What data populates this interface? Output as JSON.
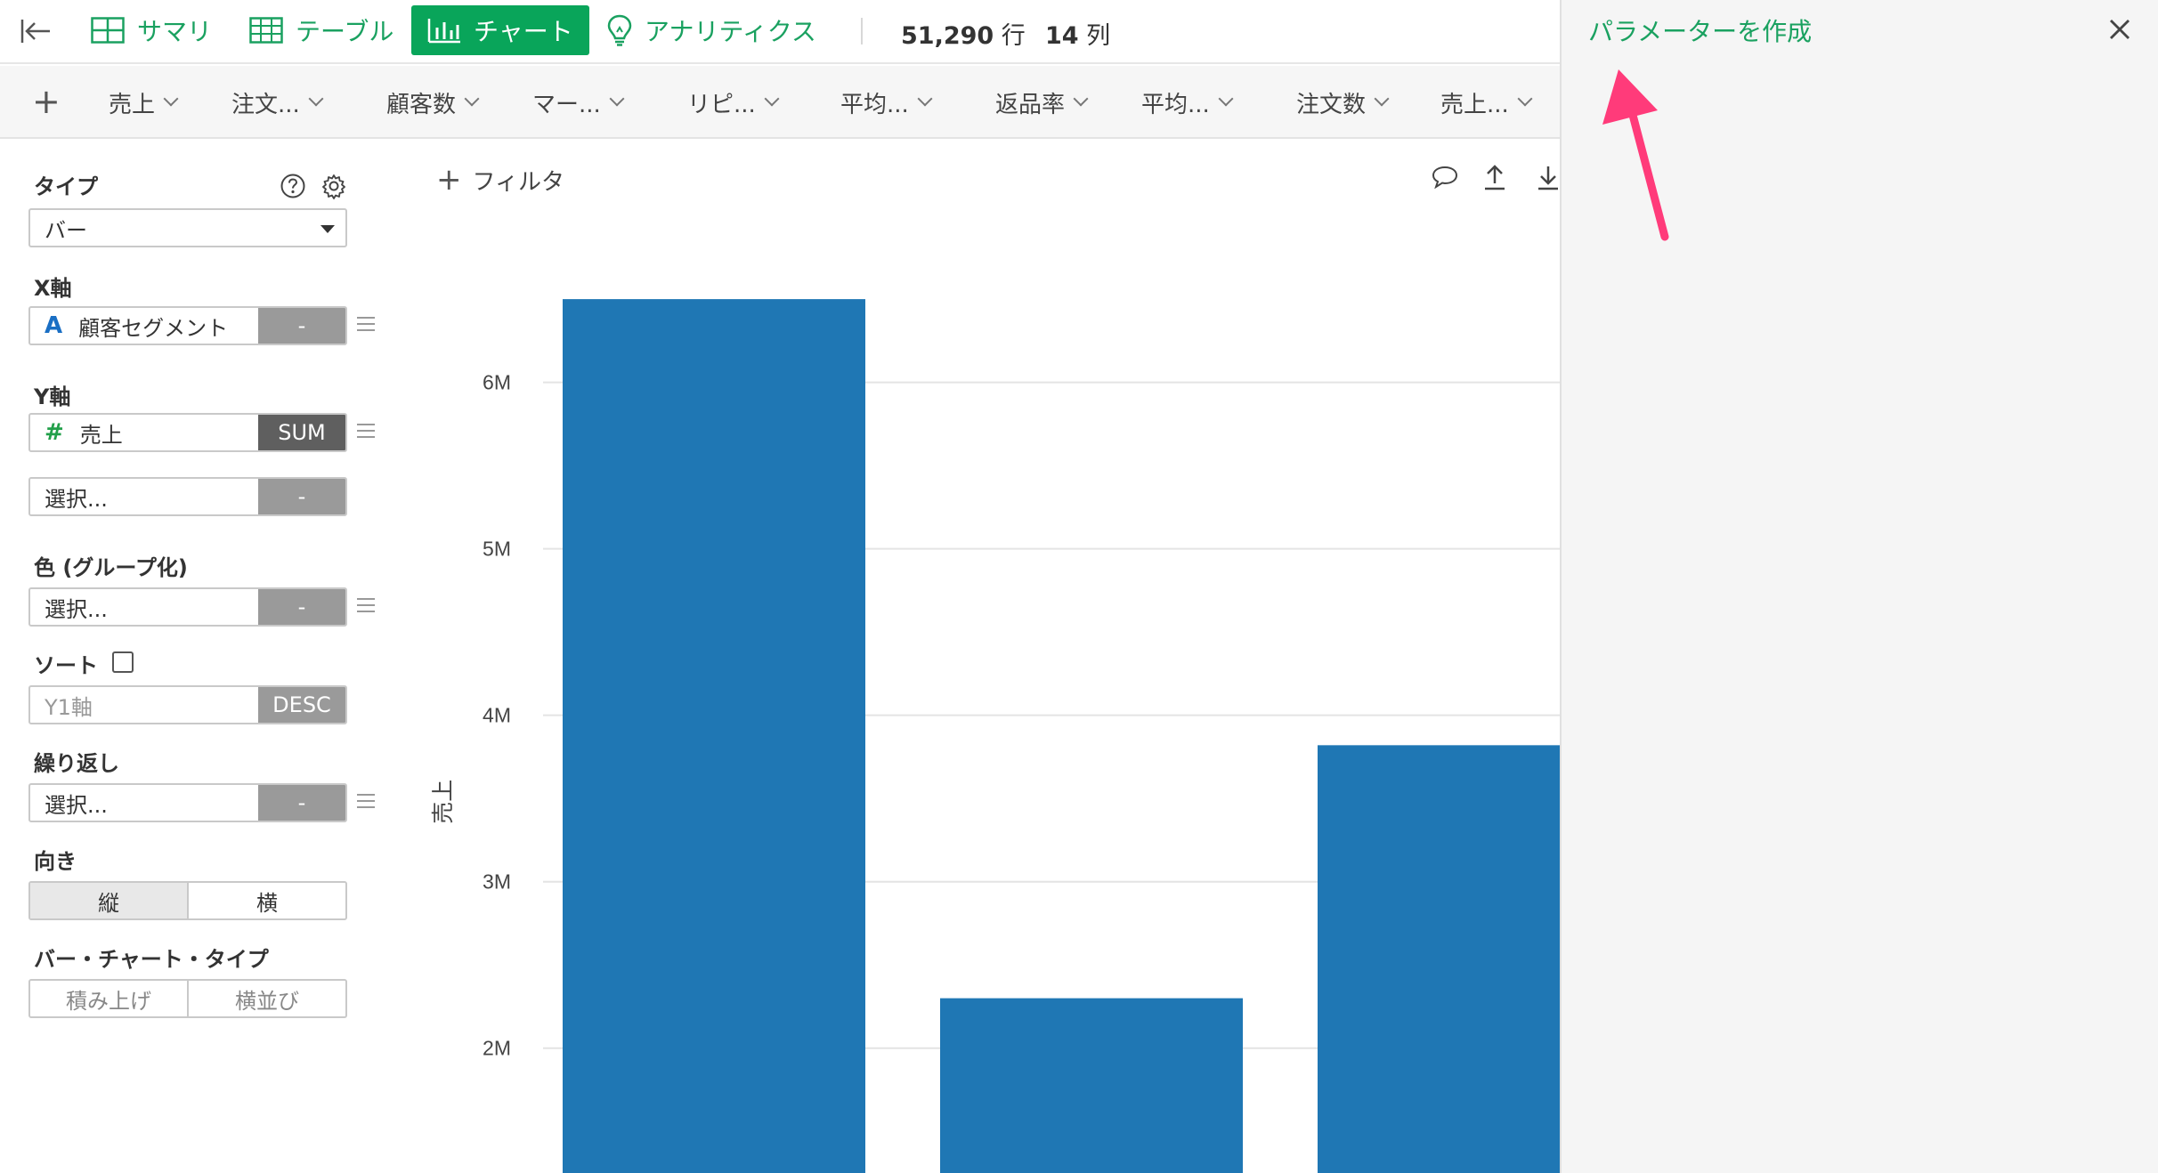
{
  "topbar": {
    "tabs": [
      {
        "label": "サマリ",
        "icon": "summary-grid-icon"
      },
      {
        "label": "テーブル",
        "icon": "table-icon"
      },
      {
        "label": "チャート",
        "icon": "bar-chart-icon",
        "active": true
      },
      {
        "label": "アナリティクス",
        "icon": "lightbulb-icon"
      }
    ],
    "rows_value": "51,290",
    "rows_unit": "行",
    "cols_value": "14",
    "cols_unit": "列",
    "accent": "#09a55a"
  },
  "columns": [
    {
      "label": "売上"
    },
    {
      "label": "注文..."
    },
    {
      "label": "顧客数"
    },
    {
      "label": "マー..."
    },
    {
      "label": "リピ..."
    },
    {
      "label": "平均..."
    },
    {
      "label": "返品率"
    },
    {
      "label": "平均..."
    },
    {
      "label": "注文数"
    },
    {
      "label": "売上..."
    }
  ],
  "config": {
    "type_label": "タイプ",
    "type_value": "バー",
    "x_label": "X軸",
    "x_field": {
      "type_glyph": "A",
      "name": "顧客セグメント",
      "agg": "-"
    },
    "y_label": "Y軸",
    "y_field": {
      "type_glyph": "#",
      "name": "売上",
      "agg": "SUM"
    },
    "y2_field": {
      "name": "選択...",
      "agg": "-"
    },
    "color_label": "色 (グループ化)",
    "color_field": {
      "name": "選択...",
      "agg": "-"
    },
    "sort_label": "ソート",
    "sort_checked": false,
    "sort_field": {
      "name": "Y1軸",
      "agg": "DESC"
    },
    "repeat_label": "繰り返し",
    "repeat_field": {
      "name": "選択...",
      "agg": "-"
    },
    "orientation_label": "向き",
    "orientation_options": [
      "縦",
      "横"
    ],
    "orientation_selected": "縦",
    "bartype_label": "バー・チャート・タイプ",
    "bartype_options": [
      "積み上げ",
      "横並び"
    ]
  },
  "chart_header": {
    "filter_label": "フィルタ"
  },
  "chart_data": {
    "type": "bar",
    "categories": [
      "",
      "",
      ""
    ],
    "values": [
      6500000,
      2300000,
      3820000
    ],
    "ylabel": "売上",
    "xlabel": "",
    "yticks": [
      "2M",
      "3M",
      "4M",
      "5M",
      "6M"
    ],
    "ylim": [
      1250000,
      6800000
    ],
    "color": "#1f77b4",
    "grid": true
  },
  "right_panel": {
    "create_label": "パラメーターを作成",
    "annotation_color": "#ff3b7a"
  }
}
